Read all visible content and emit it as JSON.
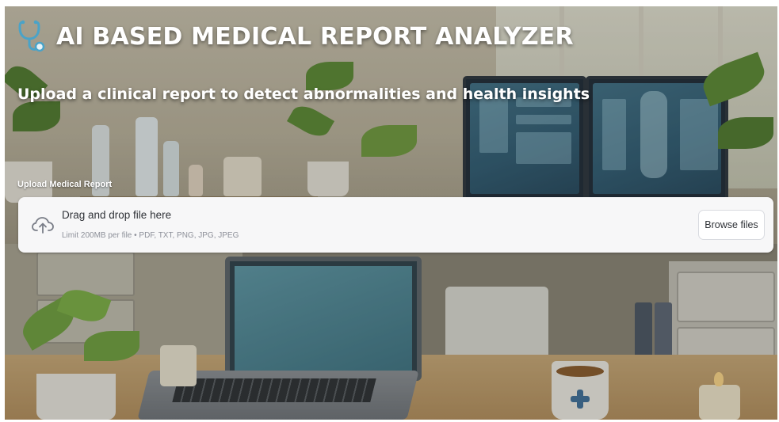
{
  "header": {
    "icon": "stethoscope-icon",
    "title": "AI BASED MEDICAL REPORT ANALYZER",
    "subtitle": "Upload a clinical report to detect abnormalities and health insights"
  },
  "uploader": {
    "label": "Upload Medical Report",
    "icon": "cloud-upload-icon",
    "drop_text": "Drag and drop file here",
    "limit_text": "Limit 200MB per file • PDF, TXT, PNG, JPG, JPEG",
    "button_label": "Browse files"
  },
  "colors": {
    "dropzone_bg": "#f7f7f8",
    "title_text": "#ffffff",
    "stethoscope": "#4aa3c8"
  }
}
